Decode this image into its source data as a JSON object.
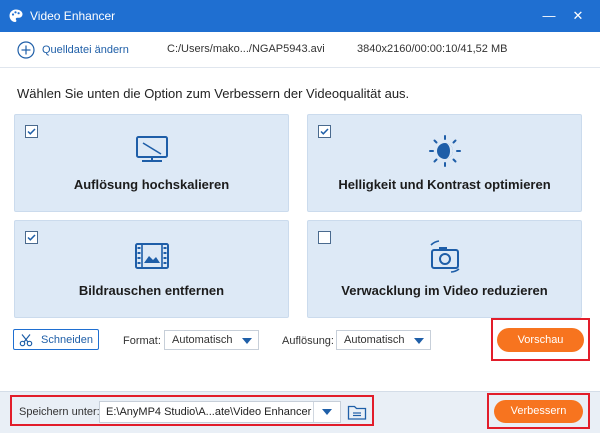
{
  "window": {
    "title": "Video Enhancer",
    "minimize_glyph": "—",
    "close_glyph": "✕"
  },
  "source": {
    "add_label": "Quelldatei ändern",
    "path": "C:/Users/mako.../NGAP5943.avi",
    "info": "3840x2160/00:00:10/41,52 MB"
  },
  "instruction": "Wählen Sie unten die Option zum Verbessern der Videoqualität aus.",
  "options": [
    {
      "label": "Auflösung hochskalieren",
      "checked": true,
      "icon": "monitor-upscale-icon"
    },
    {
      "label": "Helligkeit und Kontrast optimieren",
      "checked": true,
      "icon": "brightness-icon"
    },
    {
      "label": "Bildrauschen entfernen",
      "checked": true,
      "icon": "film-noise-icon"
    },
    {
      "label": "Verwacklung im Video reduzieren",
      "checked": false,
      "icon": "camera-shake-icon"
    }
  ],
  "controls": {
    "cut_label": "Schneiden",
    "format_label": "Format:",
    "format_value": "Automatisch",
    "resolution_label": "Auflösung:",
    "resolution_value": "Automatisch",
    "preview_label": "Vorschau"
  },
  "footer": {
    "save_label": "Speichern unter:",
    "save_path": "E:\\AnyMP4 Studio\\A...ate\\Video Enhancer",
    "enhance_label": "Verbessern"
  },
  "colors": {
    "titlebar": "#1f6fd1",
    "card": "#dde9f6",
    "accent": "#f7741f",
    "highlight": "#e21d2a"
  }
}
